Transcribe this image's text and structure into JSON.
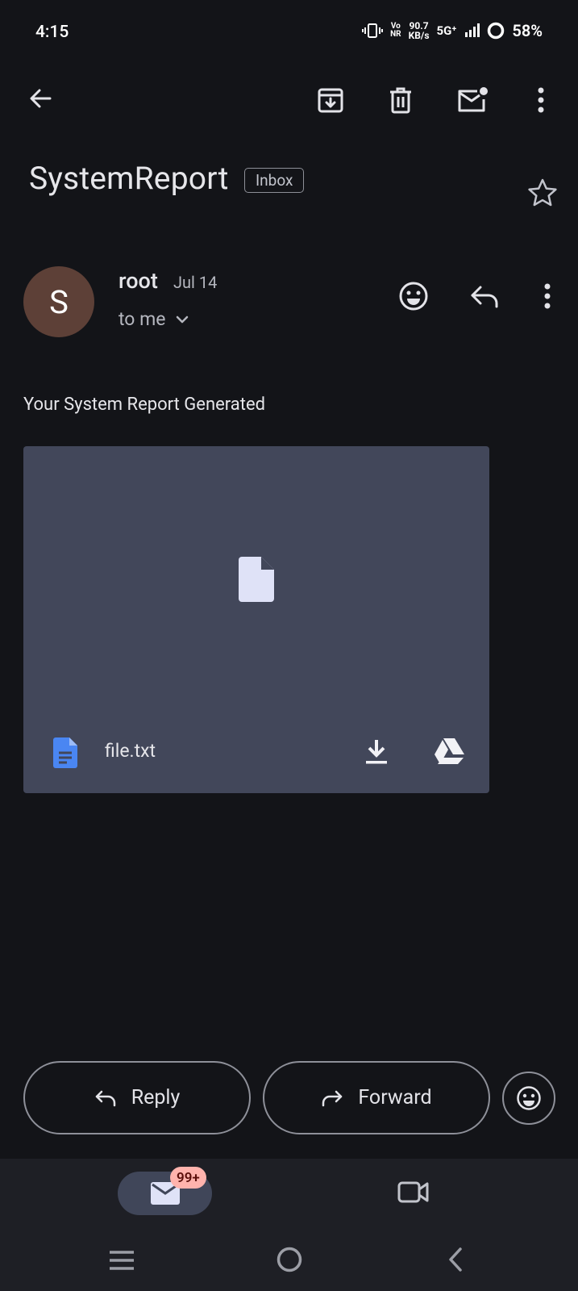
{
  "status": {
    "time": "4:15",
    "volte_top": "Vo",
    "volte_bottom": "NR",
    "speed_top": "90.7",
    "speed_bottom": "KB/s",
    "network": "5G⁺",
    "battery": "58%"
  },
  "toolbar": {
    "icons": [
      "back-arrow-icon",
      "archive-icon",
      "delete-icon",
      "mark-unread-icon",
      "more-vert-icon"
    ]
  },
  "email": {
    "subject": "SystemReport",
    "label": "Inbox",
    "avatar_letter": "S",
    "avatar_color": "#5d4037",
    "sender": "root",
    "date": "Jul 14",
    "recipient": "to me",
    "body": "Your System Report Generated",
    "attachment": {
      "name": "file.txt",
      "icon_color": "#4a86f2"
    }
  },
  "actions": {
    "reply": "Reply",
    "forward": "Forward"
  },
  "nav": {
    "badge": "99+",
    "accent": "#404659"
  }
}
